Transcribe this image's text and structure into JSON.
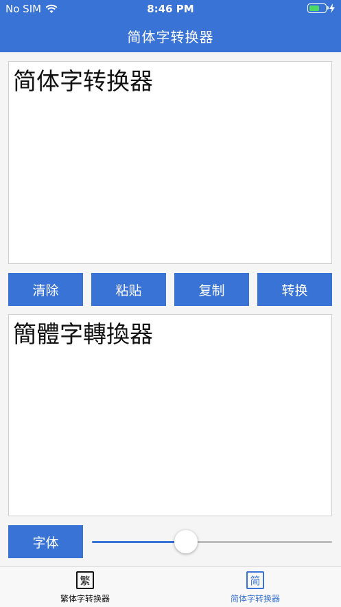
{
  "status": {
    "carrier": "No SIM",
    "time": "8:46 PM"
  },
  "nav": {
    "title": "简体字转换器"
  },
  "input": {
    "text": "简体字转换器"
  },
  "buttons": {
    "clear": "清除",
    "paste": "粘贴",
    "copy": "复制",
    "convert": "转换"
  },
  "output": {
    "text": "簡體字轉換器"
  },
  "font": {
    "label": "字体",
    "slider_level": 0.39
  },
  "tabs": [
    {
      "icon_char": "繁",
      "label": "繁体字转换器",
      "selected": false
    },
    {
      "icon_char": "简",
      "label": "简体字转换器",
      "selected": true
    }
  ],
  "colors": {
    "accent": "#3a73d6",
    "battery": "#4cd964"
  }
}
